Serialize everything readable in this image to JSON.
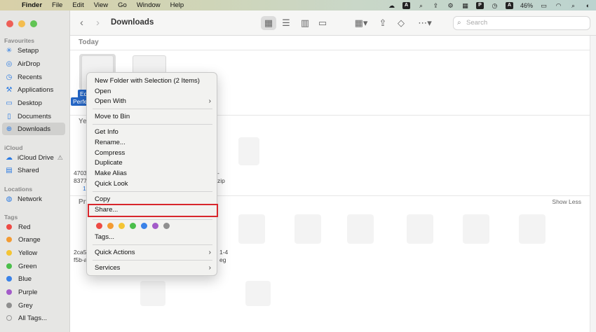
{
  "menubar": {
    "app": "Finder",
    "items": [
      "File",
      "Edit",
      "View",
      "Go",
      "Window",
      "Help"
    ],
    "battery": "46%"
  },
  "sidebar": {
    "favourites_header": "Favourites",
    "favourites": [
      "Setapp",
      "AirDrop",
      "Recents",
      "Applications",
      "Desktop",
      "Documents",
      "Downloads"
    ],
    "icloud_header": "iCloud",
    "icloud": [
      "iCloud Drive",
      "Shared"
    ],
    "locations_header": "Locations",
    "locations": [
      "Network"
    ],
    "tags_header": "Tags",
    "tags": [
      "Red",
      "Orange",
      "Yellow",
      "Green",
      "Blue",
      "Purple",
      "Grey",
      "All Tags..."
    ],
    "tag_colors": [
      "#ee4b45",
      "#f39b33",
      "#f4c534",
      "#4bbf4b",
      "#3a82e8",
      "#a35bc9",
      "#8f8f8f",
      ""
    ]
  },
  "toolbar": {
    "title": "Downloads",
    "search_placeholder": "Search"
  },
  "groups": {
    "today": "Today",
    "yesterday_partial": "Yes",
    "previous_partial": "Pr",
    "show_less": "Show Less"
  },
  "files": {
    "selected_1": "Ed",
    "selected_2": "Perfe",
    "f1_line1": "4703",
    "f1_line2": "8377",
    "f1_line3": "1,0",
    "f2_line1": "zip",
    "f3_line1": "2ca5",
    "f3_line2": "f5b-a",
    "f4_line1": "-",
    "f4_line2": "1-4",
    "f4_line3": "eg"
  },
  "context_menu": {
    "items": [
      {
        "label": "New Folder with Selection (2 Items)",
        "submenu": false
      },
      {
        "label": "Open",
        "submenu": false
      },
      {
        "label": "Open With",
        "submenu": true
      },
      {
        "label": "Move to Bin",
        "submenu": false
      },
      {
        "label": "Get Info",
        "submenu": false
      },
      {
        "label": "Rename...",
        "submenu": false
      },
      {
        "label": "Compress",
        "submenu": false
      },
      {
        "label": "Duplicate",
        "submenu": false
      },
      {
        "label": "Make Alias",
        "submenu": false
      },
      {
        "label": "Quick Look",
        "submenu": false
      },
      {
        "label": "Copy",
        "submenu": false
      },
      {
        "label": "Share...",
        "submenu": false
      },
      {
        "label": "Tags...",
        "submenu": false
      },
      {
        "label": "Quick Actions",
        "submenu": true
      },
      {
        "label": "Services",
        "submenu": true
      }
    ],
    "tag_colors": [
      "#ee4b45",
      "#f39b33",
      "#f4c534",
      "#4bbf4b",
      "#3a82e8",
      "#a35bc9",
      "#8f8f8f"
    ],
    "highlight_color": "#d8262c"
  }
}
